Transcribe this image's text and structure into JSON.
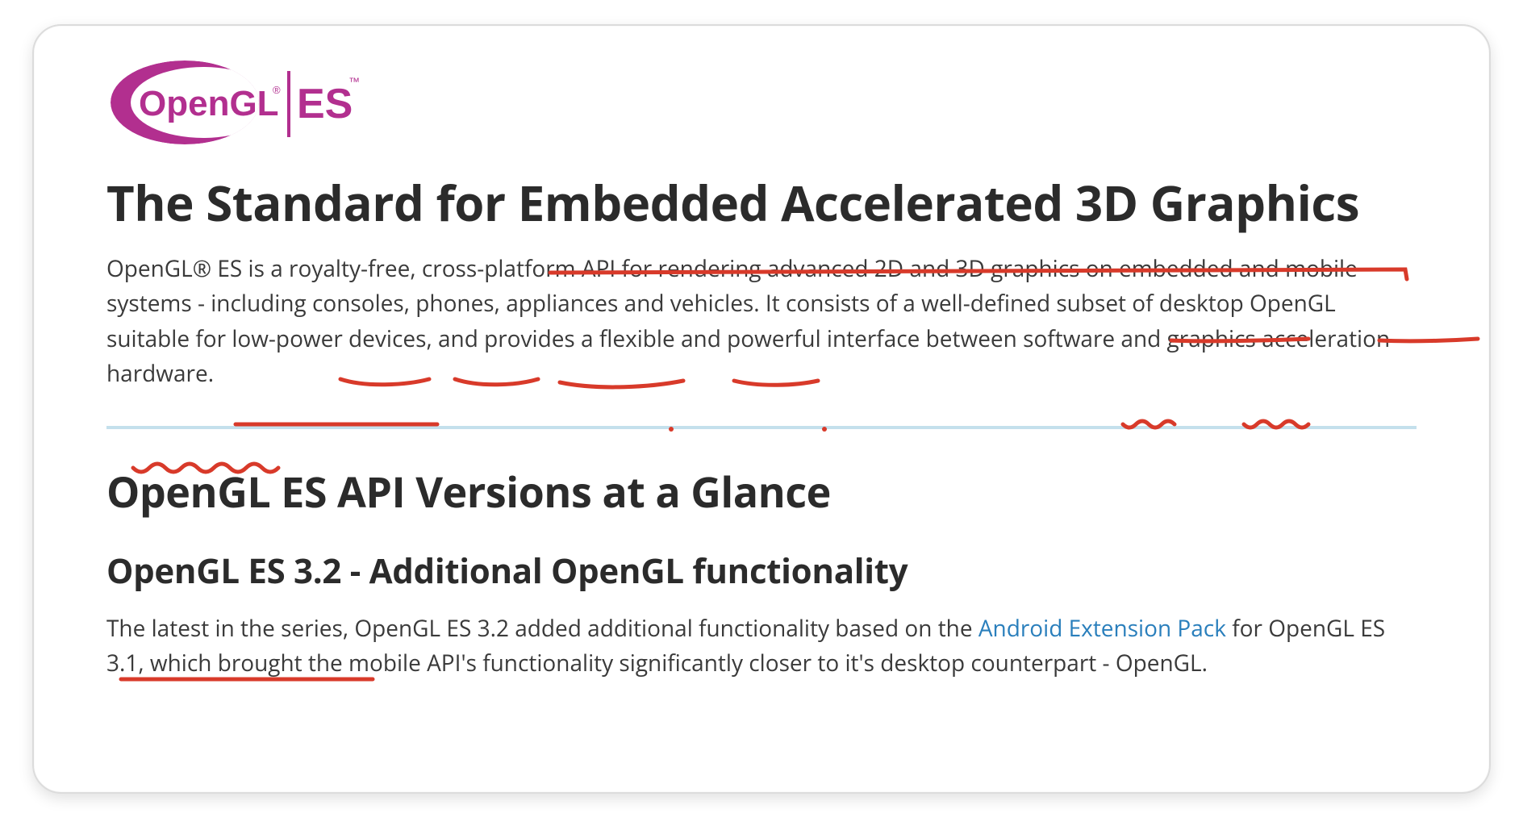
{
  "logo": {
    "brand_left": "OpenGL",
    "brand_right": "ES",
    "registered": "®",
    "tm": "™"
  },
  "heading": {
    "pre": "The Standard for ",
    "emph": "Embedded Accelerated 3D Graphics"
  },
  "intro": {
    "t1": "OpenGL® ES is a royalty-free, cross-platform API for rendering advanced 2D and 3D graphics on ",
    "w_embedded": "embedded",
    "t2": " and ",
    "w_mobile": "mobile",
    "t3": " systems - including ",
    "w_consoles": "consoles",
    "t4": ", ",
    "w_phones": "phones",
    "t5": ", ",
    "w_appliances": "appliances",
    "t6": " and ",
    "w_vehicles": "vehicles",
    "t7": ". It consists of a well-defined subset of desktop OpenGL suitable for ",
    "w_lowpower": "low-power devices",
    "t8": ", and provides a flexible and powerful interface between ",
    "w_software": "software",
    "t9": " and ",
    "w_graphics": "graphics",
    "t10": " ",
    "w_accel": "acceleration hardware",
    "t11": "."
  },
  "section_title": "OpenGL ES API Versions at a Glance",
  "subsection": {
    "emph": "OpenGL ES 3.2",
    "rest": " - Additional OpenGL functionality"
  },
  "para2": {
    "t1": "The latest in the series, OpenGL ES 3.2 added additional functionality based on the ",
    "link": "Android Extension Pack",
    "t2": " for OpenGL ES 3.1, which brought the mobile API's functionality significantly closer to it's desktop counterpart - OpenGL."
  },
  "annotations": {
    "color": "#d83a2a",
    "underlines": [
      "Embedded Accelerated 3D Graphics",
      "embedded",
      "mobile",
      "consoles",
      "phones",
      "appliances",
      "vehicles",
      "low-power devices",
      "software",
      "graphics",
      "acceleration hardware",
      "OpenGL ES 3.2"
    ]
  }
}
